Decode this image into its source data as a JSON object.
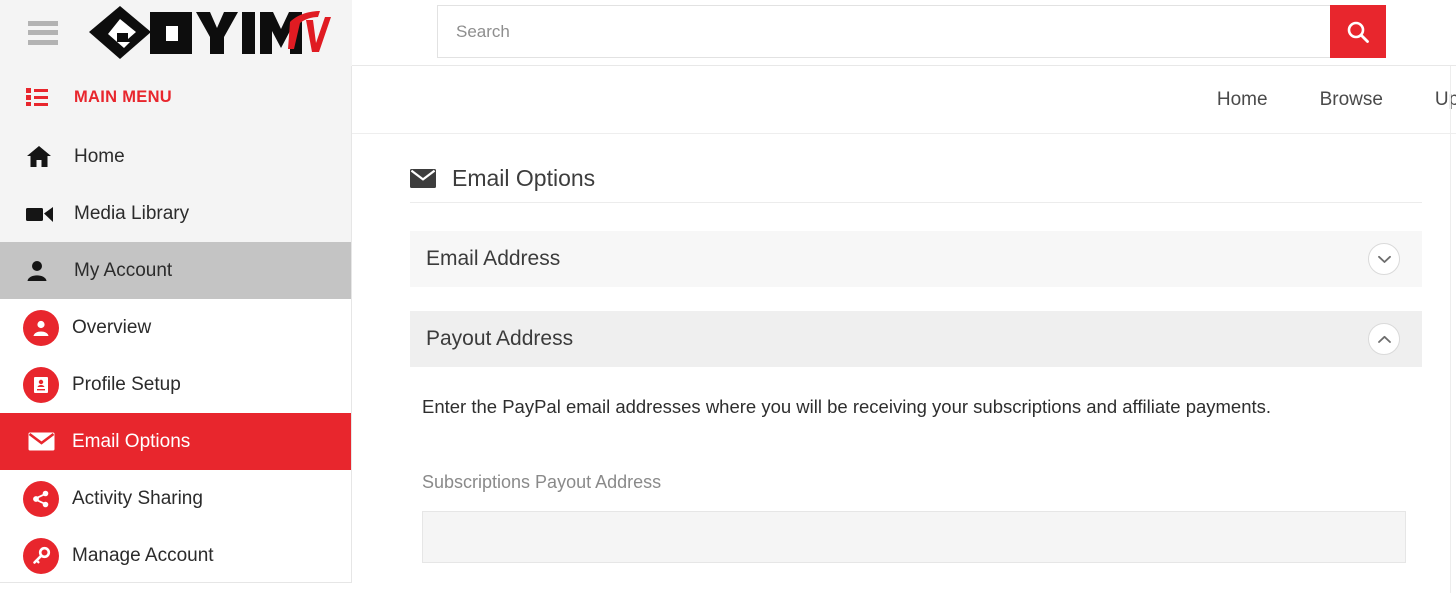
{
  "brand": {
    "logo_text_main": "OYIM",
    "logo_text_accent": "TV",
    "accent_color": "#E8262D",
    "active_red": "#E8262D",
    "selected_grey": "#c4c4c4"
  },
  "header": {
    "menu_toggle_icon": "hamburger-icon",
    "search": {
      "placeholder": "Search",
      "value": "",
      "button_icon": "search-icon"
    }
  },
  "topnav": {
    "items": [
      {
        "label": "Home"
      },
      {
        "label": "Browse"
      },
      {
        "label": "Uplo"
      }
    ]
  },
  "sidebar": {
    "section_label": "MAIN MENU",
    "section_icon": "list-icon",
    "items": [
      {
        "label": "Home",
        "icon": "home-icon",
        "style": "flat",
        "state": "default"
      },
      {
        "label": "Media Library",
        "icon": "video-icon",
        "style": "flat",
        "state": "default"
      },
      {
        "label": "My Account",
        "icon": "person-icon",
        "style": "flat",
        "state": "selected"
      },
      {
        "label": "Overview",
        "icon": "user-circle-icon",
        "style": "circle",
        "state": "default"
      },
      {
        "label": "Profile Setup",
        "icon": "id-card-icon",
        "style": "circle",
        "state": "default"
      },
      {
        "label": "Email Options",
        "icon": "envelope-icon",
        "style": "circle",
        "state": "active"
      },
      {
        "label": "Activity Sharing",
        "icon": "share-icon",
        "style": "circle",
        "state": "default"
      },
      {
        "label": "Manage Account",
        "icon": "key-icon",
        "style": "circle",
        "state": "default"
      }
    ]
  },
  "main": {
    "page_title": "Email Options",
    "page_title_icon": "envelope-icon",
    "panels": [
      {
        "title": "Email Address",
        "expanded": false,
        "chevron_icon": "chevron-down-icon"
      },
      {
        "title": "Payout Address",
        "expanded": true,
        "chevron_icon": "chevron-up-icon",
        "description": "Enter the PayPal email addresses where you will be receiving your subscriptions and affiliate payments.",
        "fields": [
          {
            "label": "Subscriptions Payout Address",
            "value": "",
            "placeholder": ""
          }
        ]
      }
    ]
  }
}
